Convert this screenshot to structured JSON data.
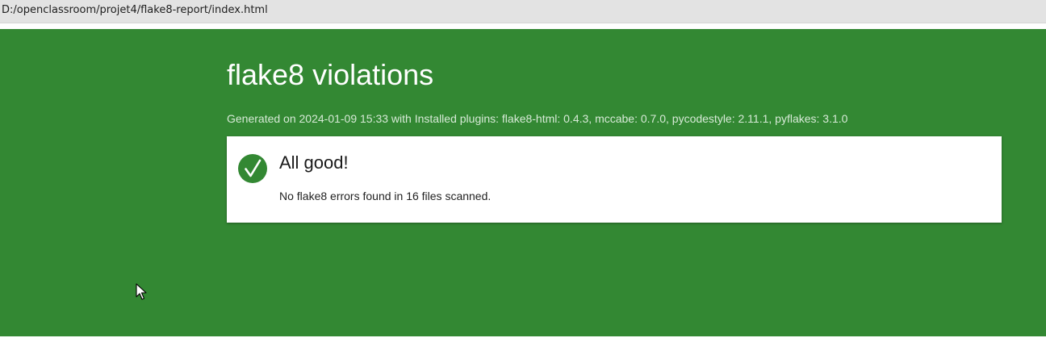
{
  "browser": {
    "address": "D:/openclassroom/projet4/flake8-report/index.html"
  },
  "report": {
    "title": "flake8 violations",
    "generated_line": "Generated on 2024-01-09 15:33 with Installed plugins: flake8-html: 0.4.3, mccabe: 0.7.0, pycodestyle: 2.11.1, pyflakes: 3.1.0"
  },
  "result": {
    "icon": "checkmark-icon",
    "heading": "All good!",
    "message": "No flake8 errors found in 16 files scanned."
  },
  "colors": {
    "page_background": "#338833",
    "card_background": "#ffffff",
    "address_bar": "#e3e3e3"
  }
}
